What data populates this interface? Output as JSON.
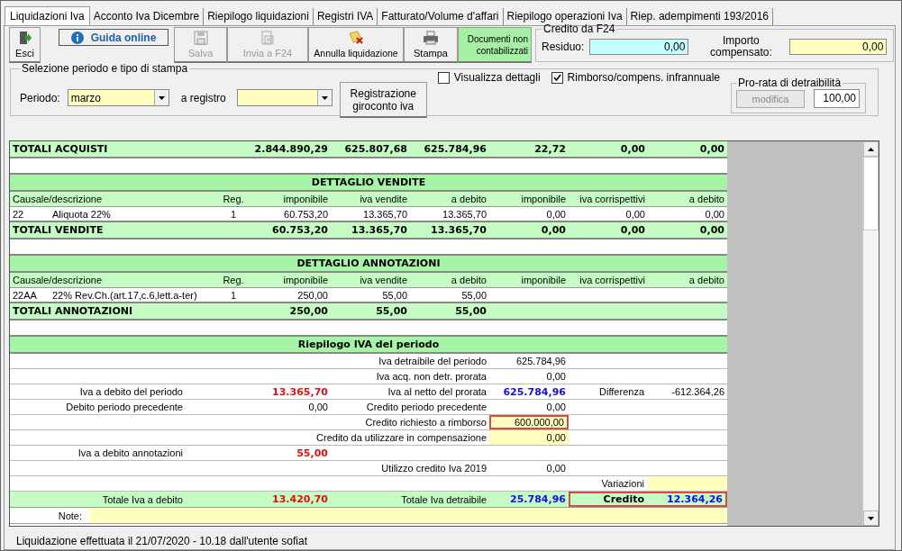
{
  "tabs": [
    {
      "label": "Liquidazioni Iva",
      "selected": true
    },
    {
      "label": "Acconto Iva Dicembre",
      "selected": false
    },
    {
      "label": "Riepilogo liquidazioni",
      "selected": false
    },
    {
      "label": "Registri IVA",
      "selected": false
    },
    {
      "label": "Fatturato/Volume d'affari",
      "selected": false
    },
    {
      "label": "Riepilogo operazioni Iva",
      "selected": false
    },
    {
      "label": "Riep. adempimenti 193/2016",
      "selected": false
    }
  ],
  "toolbar": [
    {
      "kind": "exit",
      "label": "Esci",
      "disabled": false
    },
    {
      "kind": "help",
      "label": "Guida online"
    },
    {
      "kind": "save",
      "label": "Salva",
      "disabled": true
    },
    {
      "kind": "send",
      "label": "Invia a F24",
      "disabled": true
    },
    {
      "kind": "cancel",
      "label": "Annulla liquidazione",
      "disabled": false
    },
    {
      "kind": "print",
      "label": "Stampa",
      "disabled": false
    },
    {
      "kind": "notice",
      "label": "Documenti non contabilizzati"
    }
  ],
  "credito_f24": {
    "title": "Credito da F24",
    "residuo_label": "Residuo:",
    "residuo_value": "0,00",
    "compensato_label": "Importo compensato:",
    "compensato_value": "0,00"
  },
  "selection": {
    "title": "Selezione periodo e tipo di stampa",
    "periodo_label": "Periodo:",
    "periodo_value": "marzo",
    "registro_label": "a registro",
    "giroconto_button": "Registrazione giroconto iva",
    "checkboxes": [
      {
        "label": "Visualizza dettagli",
        "checked": false
      },
      {
        "label": "Rimborso/compens. infrannuale",
        "checked": true
      }
    ],
    "prorata": {
      "title": "Pro-rata di detraibilità",
      "button": "modifica",
      "button_disabled": true,
      "value": "100,00"
    }
  },
  "grid": {
    "rows": [
      {
        "kind": "totals",
        "label": "TOTALI ACQUISTI",
        "values": [
          "2.844.890,29",
          "625.807,68",
          "625.784,96",
          "22,72",
          "0,00",
          "0,00"
        ]
      },
      {
        "kind": "blank"
      },
      {
        "kind": "section",
        "title": "DETTAGLIO VENDITE"
      },
      {
        "kind": "columns",
        "headers": [
          "Causale/descrizione",
          "Reg.",
          "imponibile",
          "iva vendite",
          "a debito",
          "imponibile",
          "iva corrispettivi",
          "a debito"
        ]
      },
      {
        "kind": "data",
        "code": "22",
        "description": "Aliquota 22%",
        "reg": "1",
        "values": [
          "60.753,20",
          "13.365,70",
          "13.365,70",
          "0,00",
          "0,00",
          "0,00"
        ]
      },
      {
        "kind": "totals",
        "label": "TOTALI VENDITE",
        "values": [
          "60.753,20",
          "13.365,70",
          "13.365,70",
          "0,00",
          "0,00",
          "0,00"
        ]
      },
      {
        "kind": "blank"
      },
      {
        "kind": "section",
        "title": "DETTAGLIO ANNOTAZIONI"
      },
      {
        "kind": "columns",
        "headers": [
          "Causale/descrizione",
          "Reg.",
          "imponibile",
          "iva vendite",
          "a debito",
          "imponibile",
          "iva corrispettivi",
          "a debito"
        ]
      },
      {
        "kind": "data",
        "code": "22AA",
        "description": "22% Rev.Ch.(art.17,c.6,lett.a-ter)",
        "reg": "1",
        "values": [
          "250,00",
          "55,00",
          "55,00"
        ]
      },
      {
        "kind": "totals",
        "label": "TOTALI ANNOTAZIONI",
        "values": [
          "250,00",
          "55,00",
          "55,00"
        ]
      },
      {
        "kind": "blank"
      },
      {
        "kind": "section",
        "title": "Riepilogo IVA del periodo"
      },
      {
        "kind": "summary",
        "right": {
          "label": "Iva detraibile del periodo",
          "value": "625.784,96",
          "kind": "plain"
        }
      },
      {
        "kind": "summary",
        "right": {
          "label": "Iva acq. non detr. prorata",
          "value": "0,00",
          "kind": "plain"
        }
      },
      {
        "kind": "summary",
        "left": {
          "label": "Iva a debito del periodo",
          "value": "13.365,70",
          "kind": "red"
        },
        "right": {
          "label": "Iva al netto del prorata",
          "value": "625.784,96",
          "kind": "blue"
        },
        "extra": {
          "label": "Differenza",
          "value": "-612.364,26",
          "kind": "plain"
        }
      },
      {
        "kind": "summary",
        "left": {
          "label": "Debito periodo precedente",
          "value": "0,00",
          "kind": "plain"
        },
        "right": {
          "label": "Credito periodo precedente",
          "value": "0,00",
          "kind": "plain"
        }
      },
      {
        "kind": "summary",
        "right": {
          "label": "Credito richiesto a rimborso",
          "value": "600.000,00",
          "kind": "plain",
          "editable": true,
          "boxed": true
        }
      },
      {
        "kind": "summary",
        "right": {
          "label": "Credito da utilizzare in compensazione",
          "value": "0,00",
          "kind": "plain",
          "editable": true
        }
      },
      {
        "kind": "summary",
        "left": {
          "label": "Iva a debito annotazioni",
          "value": "55,00",
          "kind": "red"
        }
      },
      {
        "kind": "summary",
        "right": {
          "label": "Utilizzo credito Iva 2019",
          "value": "0,00",
          "kind": "plain"
        }
      },
      {
        "kind": "summary",
        "extra": {
          "label": "Variazioni",
          "editable": true
        }
      },
      {
        "kind": "total",
        "left": {
          "label": "Totale Iva a debito",
          "value": "13.420,70",
          "kind": "red"
        },
        "right": {
          "label": "Totale Iva detraibile",
          "value": "25.784,96",
          "kind": "blue"
        },
        "extra": {
          "label": "Credito",
          "value": "12.364,26",
          "kind": "blue",
          "boxed": true
        }
      },
      {
        "kind": "note",
        "label": "Note:"
      }
    ]
  },
  "status": "Liquidazione effettuata il 21/07/2020 - 10.18 dall'utente sofiat"
}
